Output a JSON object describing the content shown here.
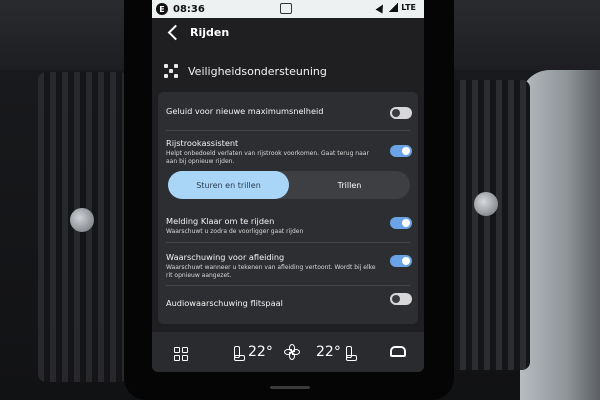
{
  "status_bar": {
    "badge": "E",
    "time": "08:36",
    "network": "LTE"
  },
  "header": {
    "title": "Rijden"
  },
  "section": {
    "title": "Veiligheidsondersteuning"
  },
  "settings": {
    "speed_limit_sound": {
      "title": "Geluid voor nieuwe maximumsnelheid",
      "state": "off"
    },
    "lane_assist": {
      "title": "Rijstrookassistent",
      "description": "Helpt onbedoeld verlaten van rijstrook voorkomen. Gaat terug naar aan bij opnieuw rijden.",
      "state": "on"
    },
    "lane_mode": {
      "options": [
        "Sturen en trillen",
        "Trillen"
      ],
      "selected": "Sturen en trillen"
    },
    "ready_to_drive": {
      "title": "Melding Klaar om te rijden",
      "description": "Waarschuwt u zodra de voorligger gaat rijden",
      "state": "on"
    },
    "distraction_warning": {
      "title": "Waarschuwing voor afleiding",
      "description": "Waarschuwt wanneer u tekenen van afleiding vertoont. Wordt bij elke rit opnieuw aangezet.",
      "state": "on"
    },
    "speed_camera_audio": {
      "title": "Audiowaarschuwing flitspaal",
      "state": "off"
    }
  },
  "climate": {
    "left_temp": "22°",
    "right_temp": "22°"
  },
  "colors": {
    "toggle_on": "#6aa3e6",
    "segment_selected": "#a9d6f7",
    "card": "#2d2e31"
  },
  "icons": [
    "back-icon",
    "car-safety-icon",
    "apps-grid-icon",
    "seat-heat-icon",
    "fan-icon",
    "car-front-icon"
  ]
}
